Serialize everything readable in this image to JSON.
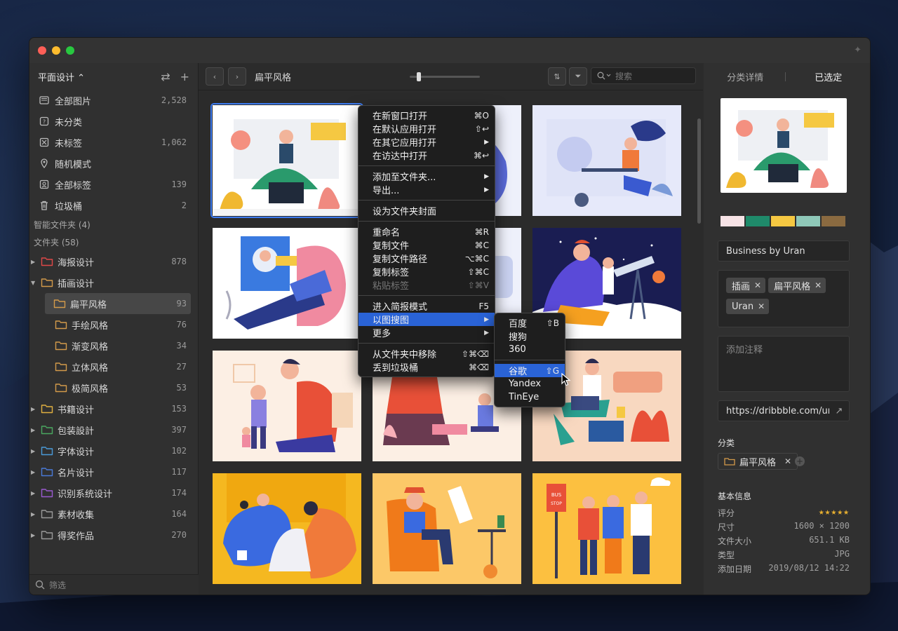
{
  "colors": {
    "accent": "#3d7bf0",
    "highlight": "#2a63d6",
    "close": "#fe5f57",
    "minimize": "#febc2e",
    "zoom": "#28c840"
  },
  "sidebar": {
    "library": "平面设计 ⌃",
    "icons": [
      "swap-icon",
      "add-icon"
    ],
    "nav": [
      {
        "label": "全部图片",
        "count": "2,528",
        "icon": "all-images-icon"
      },
      {
        "label": "未分类",
        "count": "",
        "icon": "uncategorized-icon"
      },
      {
        "label": "未标签",
        "count": "1,062",
        "icon": "untagged-icon"
      },
      {
        "label": "随机模式",
        "count": "",
        "icon": "random-icon"
      },
      {
        "label": "全部标签",
        "count": "139",
        "icon": "tags-icon"
      },
      {
        "label": "垃圾桶",
        "count": "2",
        "icon": "trash-icon"
      }
    ],
    "smart_folders": "智能文件夹 (4)",
    "folders_title": "文件夹 (58)",
    "folders": [
      {
        "label": "海报设计",
        "count": "878",
        "color": "#e04848",
        "arrow": "▶",
        "level": 0
      },
      {
        "label": "插画设计",
        "count": "",
        "color": "#d39a4a",
        "arrow": "▼",
        "level": 0
      },
      {
        "label": "扁平风格",
        "count": "93",
        "color": "#d39a4a",
        "arrow": "",
        "level": 1,
        "active": true
      },
      {
        "label": "手绘风格",
        "count": "76",
        "color": "#d39a4a",
        "arrow": "",
        "level": 1
      },
      {
        "label": "渐变风格",
        "count": "34",
        "color": "#d39a4a",
        "arrow": "",
        "level": 1
      },
      {
        "label": "立体风格",
        "count": "27",
        "color": "#d39a4a",
        "arrow": "",
        "level": 1
      },
      {
        "label": "极简风格",
        "count": "53",
        "color": "#d39a4a",
        "arrow": "",
        "level": 1
      },
      {
        "label": "书籍设计",
        "count": "153",
        "color": "#e0b040",
        "arrow": "▶",
        "level": 0
      },
      {
        "label": "包装設計",
        "count": "397",
        "color": "#4aa860",
        "arrow": "▶",
        "level": 0
      },
      {
        "label": "字体设计",
        "count": "102",
        "color": "#4a9ad8",
        "arrow": "▶",
        "level": 0
      },
      {
        "label": "名片设计",
        "count": "117",
        "color": "#4a7ad8",
        "arrow": "▶",
        "level": 0
      },
      {
        "label": "识别系统设计",
        "count": "174",
        "color": "#9a5ad0",
        "arrow": "▶",
        "level": 0
      },
      {
        "label": "素材收集",
        "count": "164",
        "color": "#9a9a9a",
        "arrow": "▶",
        "level": 0
      },
      {
        "label": "得奖作品",
        "count": "270",
        "color": "#9a9a9a",
        "arrow": "▶",
        "level": 0
      }
    ],
    "filter_placeholder": "筛选"
  },
  "toolbar": {
    "breadcrumb": "扁平风格",
    "search_placeholder": "搜索",
    "sort_label": "⇅",
    "filter_label": "⏷"
  },
  "right": {
    "tabs": [
      "分类详情",
      "已选定"
    ],
    "title": "Business by Uran",
    "tags": [
      "插画",
      "扁平风格",
      "Uran"
    ],
    "note_placeholder": "添加注释",
    "url": "https://dribbble.com/ur",
    "category_label": "分类",
    "category": "扁平风格",
    "info_title": "基本信息",
    "info": [
      {
        "k": "评分",
        "v": "★★★★★"
      },
      {
        "k": "尺寸",
        "v": "1600 × 1200"
      },
      {
        "k": "文件大小",
        "v": "651.1 KB"
      },
      {
        "k": "类型",
        "v": "JPG"
      },
      {
        "k": "添加日期",
        "v": "2019/08/12 14:22"
      }
    ],
    "swatches": [
      "#f7e3e6",
      "#1f8a6a",
      "#f5c842",
      "#8fc8b8",
      "#8a6a40"
    ]
  },
  "context_menu": [
    {
      "l": "在新窗口打开",
      "s": "⌘O"
    },
    {
      "l": "在默认应用打开",
      "s": "⇧↩"
    },
    {
      "l": "在其它应用打开",
      "s": "▶"
    },
    {
      "l": "在访达中打开",
      "s": "⌘↩"
    },
    {
      "sep": true
    },
    {
      "l": "添加至文件夹...",
      "s": "▶"
    },
    {
      "l": "导出...",
      "s": "▶"
    },
    {
      "sep": true
    },
    {
      "l": "设为文件夹封面",
      "s": ""
    },
    {
      "sep": true
    },
    {
      "l": "重命名",
      "s": "⌘R"
    },
    {
      "l": "复制文件",
      "s": "⌘C"
    },
    {
      "l": "复制文件路径",
      "s": "⌥⌘C"
    },
    {
      "l": "复制标签",
      "s": "⇧⌘C"
    },
    {
      "l": "粘贴标签",
      "s": "⇧⌘V",
      "dis": true
    },
    {
      "sep": true
    },
    {
      "l": "进入简报模式",
      "s": "F5"
    },
    {
      "l": "以图搜图",
      "s": "▶",
      "hl": true
    },
    {
      "l": "更多",
      "s": "▶"
    },
    {
      "sep": true
    },
    {
      "l": "从文件夹中移除",
      "s": "⇧⌘⌫"
    },
    {
      "l": "丢到垃圾桶",
      "s": "⌘⌫"
    }
  ],
  "submenu": [
    {
      "l": "百度",
      "s": "⇧B"
    },
    {
      "l": "搜狗",
      "s": ""
    },
    {
      "l": "360",
      "s": ""
    },
    {
      "sep": true
    },
    {
      "l": "谷歌",
      "s": "⇧G",
      "hl": true
    },
    {
      "l": "Yandex",
      "s": ""
    },
    {
      "l": "TinEye",
      "s": ""
    }
  ]
}
